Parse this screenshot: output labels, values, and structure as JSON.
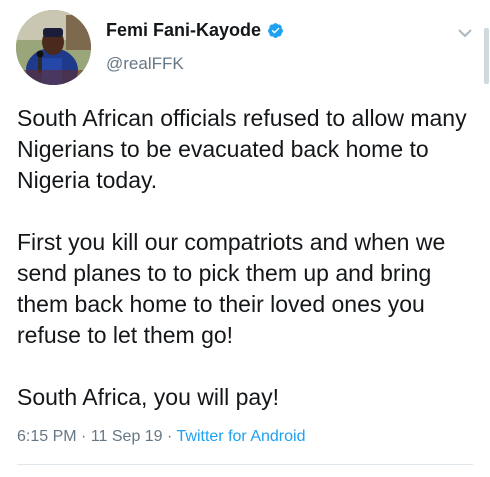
{
  "tweet": {
    "author": {
      "display_name": "Femi Fani-Kayode",
      "handle": "@realFFK",
      "avatar_icon": "avatar-photo",
      "verified_icon": "verified-badge-icon"
    },
    "menu_icon": "chevron-down-icon",
    "paragraphs": [
      "South African officials refused to allow many Nigerians to be evacuated back home to Nigeria today.",
      "First you kill our compatriots and when we send planes to to pick them up and bring them back home to their loved ones you refuse to let them go!",
      "South Africa, you will pay!"
    ],
    "meta": {
      "time": "6:15 PM",
      "separator1": " · ",
      "date": "11 Sep 19",
      "separator2": " · ",
      "source": "Twitter for Android"
    }
  },
  "colors": {
    "name_text": "#14171a",
    "secondary_text": "#657786",
    "link_blue": "#1da1f2",
    "divider": "#e1e8ed"
  }
}
